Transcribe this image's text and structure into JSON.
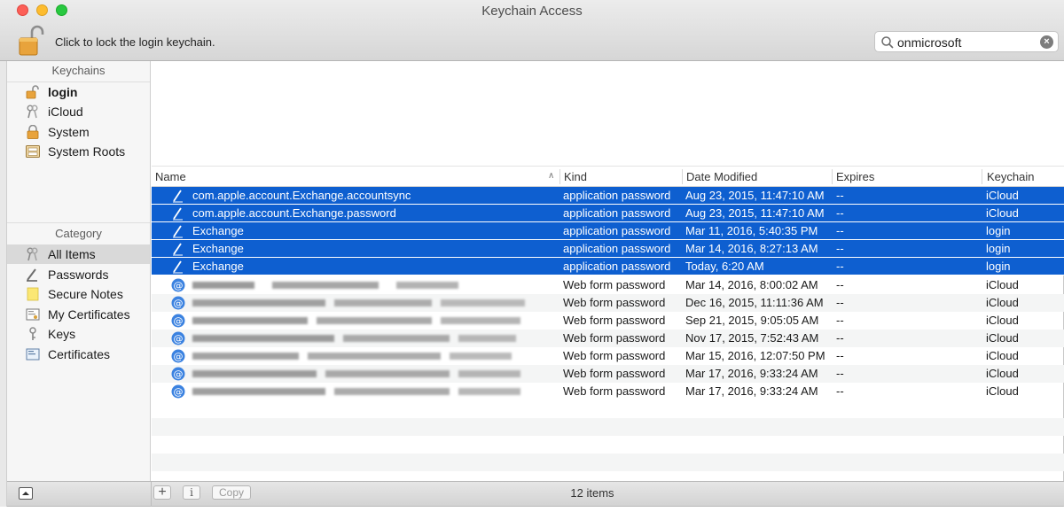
{
  "window": {
    "title": "Keychain Access"
  },
  "toolbar": {
    "lock_text": "Click to lock the login keychain.",
    "search": {
      "value": "onmicrosoft",
      "clear_icon": "clear-icon",
      "icon": "search-icon"
    }
  },
  "sidebar": {
    "keychains_header": "Keychains",
    "keychains": [
      {
        "label": "login",
        "icon": "open-padlock-icon",
        "bold": true
      },
      {
        "label": "iCloud",
        "icon": "keys-icon"
      },
      {
        "label": "System",
        "icon": "padlock-icon"
      },
      {
        "label": "System Roots",
        "icon": "cabinet-icon"
      }
    ],
    "category_header": "Category",
    "categories": [
      {
        "label": "All Items",
        "icon": "keys-icon",
        "selected": true
      },
      {
        "label": "Passwords",
        "icon": "pencil-icon"
      },
      {
        "label": "Secure Notes",
        "icon": "note-icon"
      },
      {
        "label": "My Certificates",
        "icon": "certificate-icon"
      },
      {
        "label": "Keys",
        "icon": "key-icon"
      },
      {
        "label": "Certificates",
        "icon": "certificate-icon"
      }
    ]
  },
  "table": {
    "columns": {
      "name": "Name",
      "kind": "Kind",
      "date": "Date Modified",
      "expires": "Expires",
      "keychain": "Keychain"
    },
    "rows": [
      {
        "name": "com.apple.account.Exchange.accountsync",
        "kind": "application password",
        "date": "Aug 23, 2015, 11:47:10 AM",
        "expires": "--",
        "keychain": "iCloud",
        "selected": true,
        "icon": "pencil-icon"
      },
      {
        "name": "com.apple.account.Exchange.password",
        "kind": "application password",
        "date": "Aug 23, 2015, 11:47:10 AM",
        "expires": "--",
        "keychain": "iCloud",
        "selected": true,
        "icon": "pencil-icon"
      },
      {
        "name": "Exchange",
        "kind": "application password",
        "date": "Mar 11, 2016, 5:40:35 PM",
        "expires": "--",
        "keychain": "login",
        "selected": true,
        "icon": "pencil-icon"
      },
      {
        "name": "Exchange",
        "kind": "application password",
        "date": "Mar 14, 2016, 8:27:13 AM",
        "expires": "--",
        "keychain": "login",
        "selected": true,
        "icon": "pencil-icon"
      },
      {
        "name": "Exchange",
        "kind": "application password",
        "date": "Today, 6:20 AM",
        "expires": "--",
        "keychain": "login",
        "selected": true,
        "icon": "pencil-icon"
      },
      {
        "name": "",
        "kind": "Web form password",
        "date": "Mar 14, 2016, 8:00:02 AM",
        "expires": "--",
        "keychain": "iCloud",
        "selected": false,
        "icon": "at-sign-icon"
      },
      {
        "name": "",
        "kind": "Web form password",
        "date": "Dec 16, 2015, 11:11:36 AM",
        "expires": "--",
        "keychain": "iCloud",
        "selected": false,
        "icon": "at-sign-icon"
      },
      {
        "name": "",
        "kind": "Web form password",
        "date": "Sep 21, 2015, 9:05:05 AM",
        "expires": "--",
        "keychain": "iCloud",
        "selected": false,
        "icon": "at-sign-icon"
      },
      {
        "name": "",
        "kind": "Web form password",
        "date": "Nov 17, 2015, 7:52:43 AM",
        "expires": "--",
        "keychain": "iCloud",
        "selected": false,
        "icon": "at-sign-icon"
      },
      {
        "name": "",
        "kind": "Web form password",
        "date": "Mar 15, 2016, 12:07:50 PM",
        "expires": "--",
        "keychain": "iCloud",
        "selected": false,
        "icon": "at-sign-icon"
      },
      {
        "name": "",
        "kind": "Web form password",
        "date": "Mar 17, 2016, 9:33:24 AM",
        "expires": "--",
        "keychain": "iCloud",
        "selected": false,
        "icon": "at-sign-icon"
      },
      {
        "name": "",
        "kind": "Web form password",
        "date": "Mar 17, 2016, 9:33:24 AM",
        "expires": "--",
        "keychain": "iCloud",
        "selected": false,
        "icon": "at-sign-icon"
      }
    ]
  },
  "bottombar": {
    "add_label": "+",
    "info_label": "i",
    "copy_label": "Copy",
    "status": "12 items"
  },
  "colors": {
    "selection": "#0e5fd0",
    "close": "#fc5f57",
    "minimize": "#fdbc2e",
    "maximize": "#28c840"
  }
}
